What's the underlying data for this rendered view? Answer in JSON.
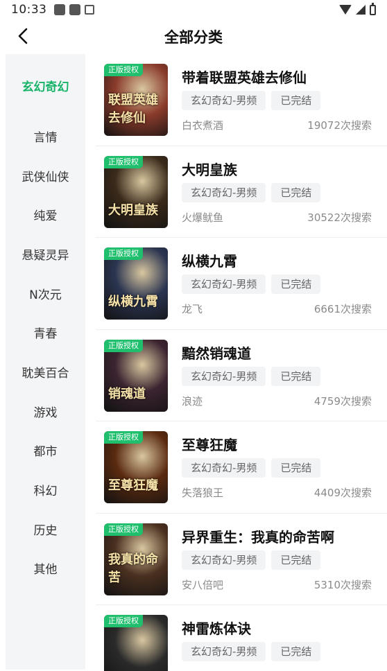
{
  "status": {
    "time": "10:33"
  },
  "header": {
    "title": "全部分类"
  },
  "sidebar": {
    "items": [
      {
        "label": "玄幻奇幻",
        "active": true
      },
      {
        "label": "言情"
      },
      {
        "label": "武侠仙侠"
      },
      {
        "label": "纯爱"
      },
      {
        "label": "悬疑灵异"
      },
      {
        "label": "N次元"
      },
      {
        "label": "青春"
      },
      {
        "label": "耽美百合"
      },
      {
        "label": "游戏"
      },
      {
        "label": "都市"
      },
      {
        "label": "科幻"
      },
      {
        "label": "历史"
      },
      {
        "label": "其他"
      }
    ]
  },
  "books": [
    {
      "title": "带着联盟英雄去修仙",
      "category": "玄幻奇幻-男频",
      "status": "已完结",
      "author": "白衣煮酒",
      "searches": "19072次搜索",
      "badge": "正版授权",
      "cover_text": "联盟英雄去修仙",
      "cover_color": "#8a3b2b"
    },
    {
      "title": "大明皇族",
      "category": "玄幻奇幻-男频",
      "status": "已完结",
      "author": "火爆鱿鱼",
      "searches": "30522次搜索",
      "badge": "正版授权",
      "cover_text": "大明皇族",
      "cover_color": "#3a2a1a"
    },
    {
      "title": "纵横九霄",
      "category": "玄幻奇幻-男频",
      "status": "已完结",
      "author": "龙飞",
      "searches": "6661次搜索",
      "badge": "正版授权",
      "cover_text": "纵横九霄",
      "cover_color": "#2b3550"
    },
    {
      "title": "黯然销魂道",
      "category": "玄幻奇幻-男频",
      "status": "已完结",
      "author": "浪迹",
      "searches": "4759次搜索",
      "badge": "正版授权",
      "cover_text": "销魂道",
      "cover_color": "#3b2430"
    },
    {
      "title": "至尊狂魔",
      "category": "玄幻奇幻-男频",
      "status": "已完结",
      "author": "失落狼王",
      "searches": "4409次搜索",
      "badge": "正版授权",
      "cover_text": "至尊狂魔",
      "cover_color": "#5a2a10"
    },
    {
      "title": "异界重生：我真的命苦啊",
      "category": "玄幻奇幻-男频",
      "status": "已完结",
      "author": "安八倍吧",
      "searches": "5310次搜索",
      "badge": "正版授权",
      "cover_text": "我真的命苦",
      "cover_color": "#4a3020"
    },
    {
      "title": "神雷炼体诀",
      "category": "玄幻奇幻-男频",
      "status": "已完结",
      "author": "",
      "searches": "",
      "badge": "正版授权",
      "cover_text": "",
      "cover_color": "#2a2a2a"
    }
  ]
}
